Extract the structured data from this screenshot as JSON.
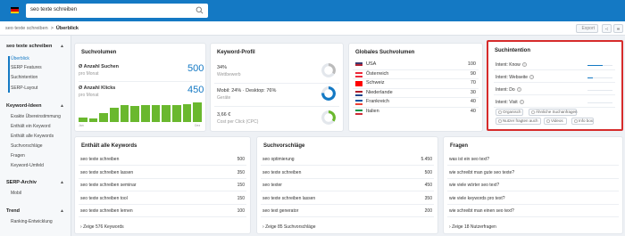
{
  "header": {
    "flag_colors": [
      "#000000",
      "#dd0000",
      "#ffce00"
    ],
    "search_value": "seo texte schreiben",
    "search_icon": "search-icon"
  },
  "breadcrumb": {
    "root": "seo texte schreiben",
    "separator": ">",
    "current": "Überblick"
  },
  "toolbar": {
    "export_label": "Export",
    "share_icon": "share-icon",
    "layout_icon": "layout-icon"
  },
  "sidebar": {
    "groups": [
      {
        "label": "seo texte schreiben",
        "items": [
          "Überblick",
          "SERP Features",
          "Suchintention",
          "SERP-Layout"
        ]
      },
      {
        "label": "Keyword-Ideen",
        "items": [
          "Exakte Übereinstimmung",
          "Enthält ein Keyword",
          "Enthält alle Keywords",
          "Suchvorschläge",
          "Fragen",
          "Keyword-Umfeld"
        ]
      },
      {
        "label": "SERP-Archiv",
        "items": [
          "Mobil"
        ]
      },
      {
        "label": "Trend",
        "items": [
          "Ranking-Entwicklung"
        ]
      }
    ]
  },
  "suchvolumen": {
    "title": "Suchvolumen",
    "suchen_label": "Ø Anzahl Suchen",
    "suchen_sub": "pro Monat",
    "suchen_value": "500",
    "klicks_label": "Ø Anzahl Klicks",
    "klicks_sub": "pro Monat",
    "klicks_value": "450",
    "chart_start": "Jan",
    "chart_end": "Dez",
    "bar_levels": [
      0.25,
      0.2,
      0.45,
      0.75,
      0.85,
      0.8,
      0.85,
      0.85,
      0.85,
      0.85,
      0.9,
      1.0
    ]
  },
  "keyword_profil": {
    "title": "Keyword-Profil",
    "rows": [
      {
        "value": "34%",
        "label": "Wettbewerb",
        "gauge": 0.34,
        "color": "#bbbbbb"
      },
      {
        "value": "Mobil: 24% · Desktop: 76%",
        "label": "Geräte",
        "gauge": 0.76,
        "color": "#1479c4"
      },
      {
        "value": "3,66 €",
        "label": "Cost per Click (CPC)",
        "gauge": 0.35,
        "color": "#6ab82e"
      }
    ]
  },
  "global": {
    "title": "Globales Suchvolumen",
    "rows": [
      {
        "country": "USA",
        "value": "100",
        "colors": [
          "#3c3b6e",
          "#b22234",
          "#ffffff"
        ]
      },
      {
        "country": "Österreich",
        "value": "90",
        "colors": [
          "#ed2939",
          "#ffffff",
          "#ed2939"
        ]
      },
      {
        "country": "Schweiz",
        "value": "70",
        "colors": [
          "#ff0000",
          "#ff0000",
          "#ff0000"
        ]
      },
      {
        "country": "Niederlande",
        "value": "30",
        "colors": [
          "#ae1c28",
          "#ffffff",
          "#21468b"
        ]
      },
      {
        "country": "Frankreich",
        "value": "40",
        "colors": [
          "#0055a4",
          "#ffffff",
          "#ef4135"
        ]
      },
      {
        "country": "Italien",
        "value": "40",
        "colors": [
          "#009246",
          "#ffffff",
          "#ce2b37"
        ]
      }
    ]
  },
  "intent": {
    "title": "Suchintention",
    "rows": [
      {
        "label": "Intent: Know",
        "level": 0.6
      },
      {
        "label": "Intent: Webseite",
        "level": 0.2
      },
      {
        "label": "Intent: Do",
        "level": 0.0
      },
      {
        "label": "Intent: Visit",
        "level": 0.0
      }
    ],
    "tags": [
      "Organisch",
      "Ähnliche Suchanfragen",
      "Nutzer fragten auch",
      "Videos",
      "Info box"
    ]
  },
  "keywords": {
    "title": "Enthält alle Keywords",
    "rows": [
      {
        "term": "seo texte schreiben",
        "value": "500"
      },
      {
        "term": "seo texte schreiben lassen",
        "value": "350"
      },
      {
        "term": "seo texte schreiben seminar",
        "value": "150"
      },
      {
        "term": "seo texte schreiben tool",
        "value": "150"
      },
      {
        "term": "seo texte schreiben lernen",
        "value": "100"
      }
    ],
    "more": "Zeige 576 Keywords"
  },
  "vorschlaege": {
    "title": "Suchvorschläge",
    "rows": [
      {
        "term": "seo optimierung",
        "value": "5.450"
      },
      {
        "term": "seo texte schreiben",
        "value": "500"
      },
      {
        "term": "seo texter",
        "value": "450"
      },
      {
        "term": "seo texte schreiben lassen",
        "value": "350"
      },
      {
        "term": "seo text generator",
        "value": "200"
      }
    ],
    "more": "Zeige 85 Suchvorschläge"
  },
  "fragen": {
    "title": "Fragen",
    "rows": [
      "was ist ein seo text?",
      "wie schreibt man gute seo texte?",
      "wie viele wörter seo text?",
      "wie viele keywords pro text?",
      "wie schreibt man einen seo text?"
    ],
    "more": "Zeige 18 Nutzerfragen"
  }
}
